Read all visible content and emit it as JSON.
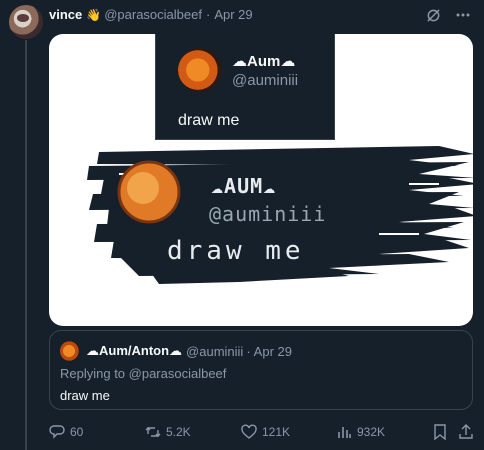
{
  "tweet": {
    "display_name": "vince",
    "badge_icon": "hand-emoji-icon",
    "handle": "@parasocialbeef",
    "separator": "·",
    "date": "Apr 29"
  },
  "media": {
    "quoted_name": "☁Aum☁",
    "quoted_handle": "@auminiii",
    "quoted_text": "draw me",
    "drawn_name": "☁AUM☁",
    "drawn_handle": "@auminiii",
    "drawn_text": "draw me"
  },
  "quote": {
    "name": "☁Aum/Anton☁",
    "handle": "@auminiii",
    "separator": "·",
    "date": "Apr 29",
    "replying": "Replying to @parasocialbeef",
    "text": "draw me"
  },
  "actions": {
    "replies": "60",
    "retweets": "5.2K",
    "likes": "121K",
    "views": "932K"
  },
  "colors": {
    "background": "#15202b",
    "muted": "#8b98a5",
    "border": "#38444d"
  }
}
